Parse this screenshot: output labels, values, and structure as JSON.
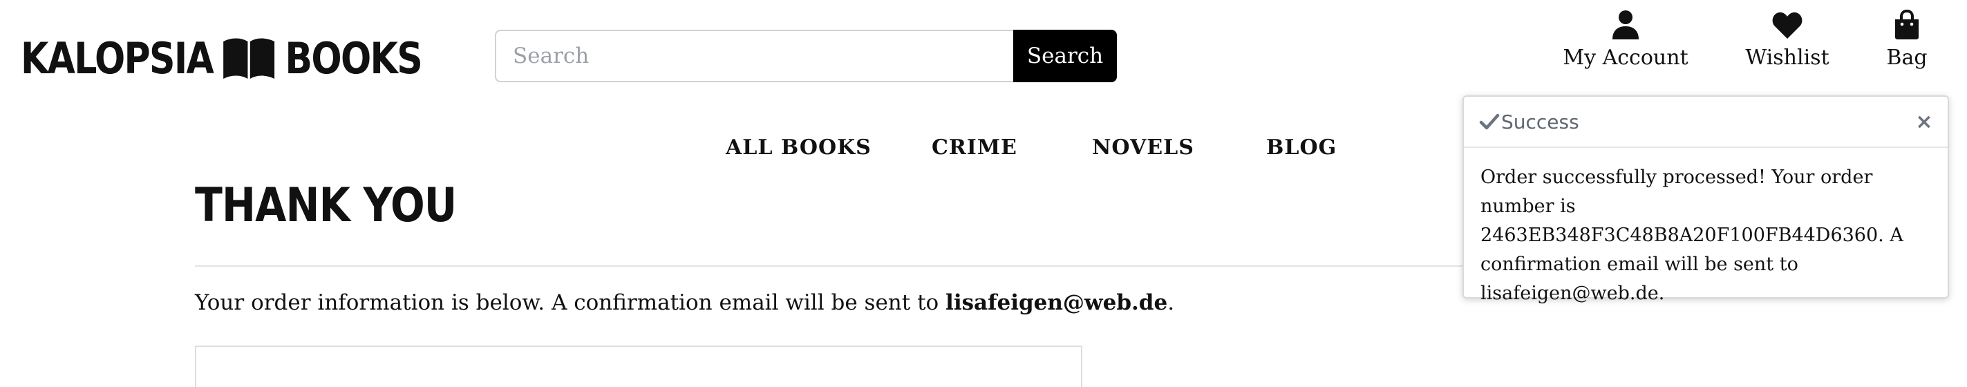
{
  "brand": {
    "name_left": "KALOPSIA",
    "name_right": "BOOKS",
    "logo_icon": "open-book-icon"
  },
  "search": {
    "placeholder": "Search",
    "value": "",
    "button_label": "Search"
  },
  "header_actions": [
    {
      "label": "My Account",
      "icon": "user-icon"
    },
    {
      "label": "Wishlist",
      "icon": "heart-icon"
    },
    {
      "label": "Bag",
      "icon": "shopping-bag-icon"
    }
  ],
  "nav": {
    "items": [
      {
        "label": "ALL BOOKS"
      },
      {
        "label": "CRIME"
      },
      {
        "label": "NOVELS"
      },
      {
        "label": "BLOG"
      }
    ]
  },
  "page": {
    "title": "THANK YOU",
    "info_text": "Your order information is below. A confirmation email will be sent to ",
    "email": "lisafeigen@web.de",
    "info_suffix": "."
  },
  "toast": {
    "title": "Success",
    "icon": "check-icon",
    "close_label": "×",
    "message": "Order successfully processed! Your order number is 2463EB348F3C48B8A20F100FB44D6360. A confirmation email will be sent to lisafeigen@web.de."
  },
  "colors": {
    "text": "#111111",
    "search_button_bg": "#000000",
    "border": "#d2d2d2",
    "toast_muted": "#6c757d"
  }
}
